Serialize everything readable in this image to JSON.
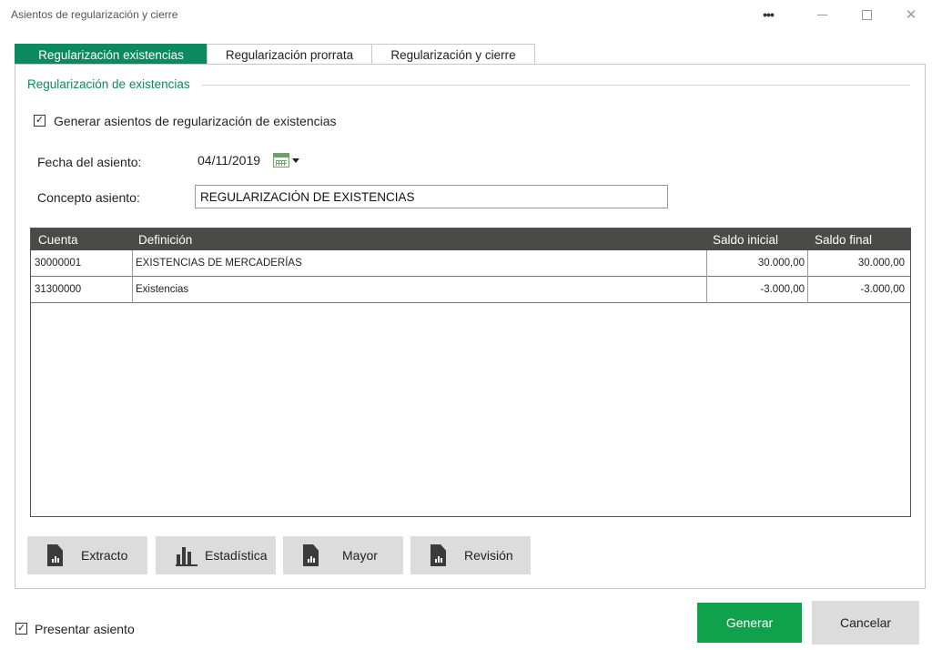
{
  "window": {
    "title": "Asientos de regularización y cierre",
    "more_label": "•••",
    "close_label": "✕"
  },
  "tabs": [
    {
      "label": "Regularización existencias",
      "active": true
    },
    {
      "label": "Regularización prorrata",
      "active": false
    },
    {
      "label": "Regularización y cierre",
      "active": false
    }
  ],
  "section": {
    "title": "Regularización de existencias"
  },
  "generate_checkbox": {
    "label": "Generar asientos de regularización de existencias",
    "checked": true,
    "mark": "✓"
  },
  "fecha": {
    "label": "Fecha del asiento:",
    "value": "04/11/2019"
  },
  "concepto": {
    "label": "Concepto asiento:",
    "value": "REGULARIZACIÓN DE EXISTENCIAS"
  },
  "grid": {
    "columns": [
      "Cuenta",
      "Definición",
      "Saldo inicial",
      "Saldo final"
    ],
    "rows": [
      {
        "cuenta": "30000001",
        "definicion": "EXISTENCIAS DE MERCADERÍAS",
        "saldo_inicial": "30.000,00",
        "saldo_final": "30.000,00"
      },
      {
        "cuenta": "31300000",
        "definicion": "Existencias",
        "saldo_inicial": "-3.000,00",
        "saldo_final": "-3.000,00"
      }
    ]
  },
  "buttons": {
    "extracto": "Extracto",
    "estadistica": "Estadística",
    "mayor": "Mayor",
    "revision": "Revisión",
    "generar": "Generar",
    "cancelar": "Cancelar"
  },
  "presentar_checkbox": {
    "label": "Presentar asiento",
    "checked": true,
    "mark": "✓"
  },
  "colors": {
    "accent": "#0b8a5f",
    "generar": "#0fa14b",
    "grid_header": "#4a4a48"
  }
}
